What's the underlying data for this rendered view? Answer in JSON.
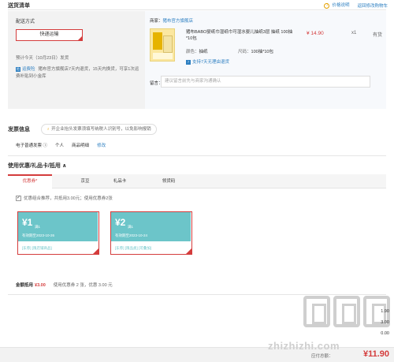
{
  "header": {
    "title": "送货清单",
    "links": [
      "价格说明",
      "返回修改购物车"
    ]
  },
  "shipping": {
    "method_label": "配送方式",
    "method_button": "快递运输",
    "eta": "预计今天（10月23日）发货",
    "service_tag": "运费险",
    "service_text": "猪布官方旗舰店7天内退货，15天内换货，可享1次运费补贴到小金库"
  },
  "store": {
    "seller_label": "商家：",
    "seller_name": "猪布官方旗舰店",
    "product_name": "猪布BABO婴纸巾湿纸巾可湿水婴儿抽纸3层 抽纸 100抽*10包",
    "price": "¥ 14.90",
    "qty": "x1",
    "stock": "有货",
    "color_label": "颜色：",
    "color_value": "抽纸",
    "size_label": "尺码：",
    "size_value": "100抽*10包",
    "return_tag": "支持7天无理由退货",
    "note_label": "留言：",
    "note_placeholder": "建议留言前先与商家沟通确认"
  },
  "invoice": {
    "title": "发票信息",
    "tip": "开企业抬头发票须填写纳税人识别号，以免影响报销",
    "type": "电子普通发票 ⓘ",
    "holder": "个人",
    "content": "商品明细",
    "edit": "修改"
  },
  "coupons": {
    "title": "使用优惠/礼品卡/抵用 ∧",
    "tabs": [
      "优惠券*",
      "京豆",
      "礼品卡",
      "领货码"
    ],
    "auto_recommend": "优惠组合推荐，共抵用3.00元；使用优惠券2张",
    "items": [
      {
        "amount": "¥1",
        "cond": "满1",
        "valid": "有效期至2023-10-26",
        "tags": "[东券]  [限店铺商品]"
      },
      {
        "amount": "¥2",
        "cond": "满1",
        "valid": "有效期至2023-10-24",
        "tags": "[东券]  [限品类]  [可叠加]"
      }
    ],
    "summary_label": "金额抵用",
    "summary_amount": "¥3.00",
    "summary_text": "使用优惠券 2 张，优惠 3.00 元"
  },
  "totals": {
    "r1": "1.90",
    "r2": "3.00",
    "r3": "0.00",
    "payable_label": "应付总额：",
    "payable_value": "¥11.90"
  },
  "watermark": {
    "text": "zhizhizhi.com"
  },
  "colors": {
    "accent": "#d43c3c",
    "link": "#2d7fc1",
    "coupon": "#6cc5c9"
  }
}
